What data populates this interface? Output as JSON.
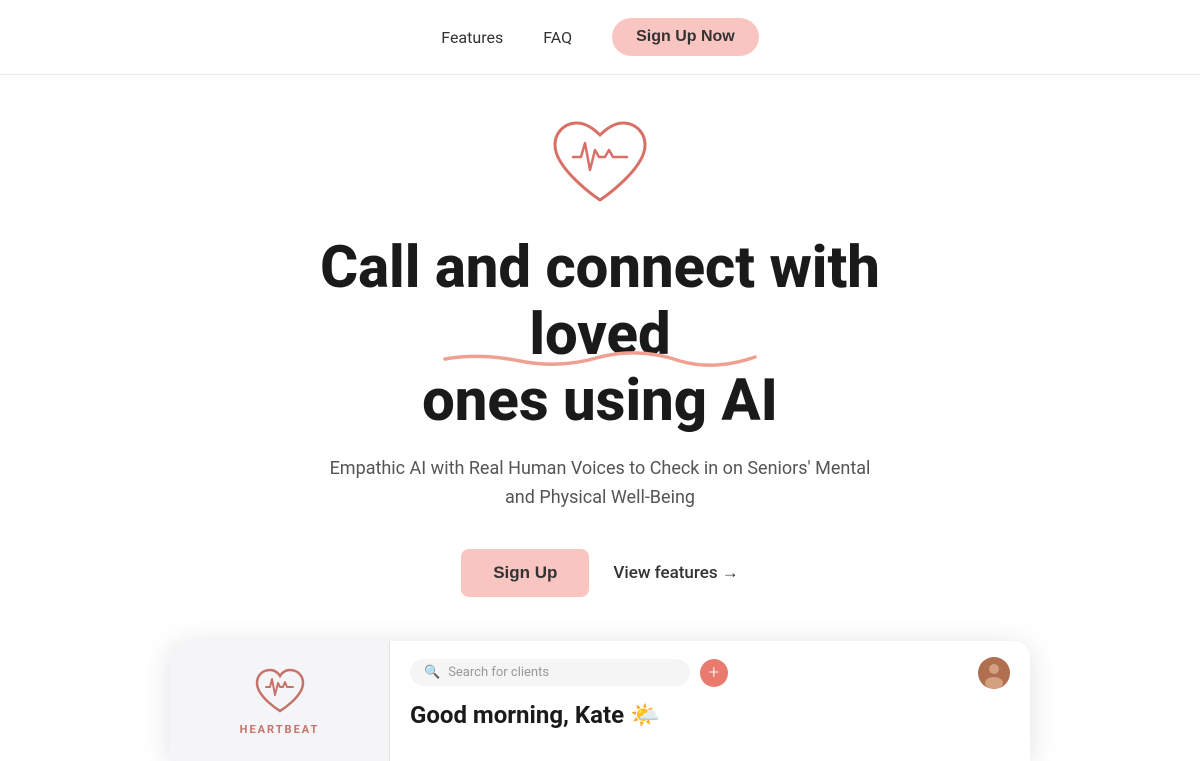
{
  "nav": {
    "features_label": "Features",
    "faq_label": "FAQ",
    "signup_now_label": "Sign Up Now"
  },
  "hero": {
    "title_line1": "Call and connect with loved",
    "title_line2": "ones using AI",
    "subtitle": "Empathic AI with Real Human Voices to Check in on Seniors' Mental and Physical Well-Being",
    "signup_label": "Sign Up",
    "view_features_label": "View features →"
  },
  "app_preview": {
    "search_placeholder": "Search for clients",
    "greeting": "Good morning, Kate 🌤️",
    "brand_name": "HEARTBEAT",
    "add_icon": "+"
  },
  "colors": {
    "accent": "#f9c5c0",
    "brand_red": "#c4746a",
    "button_red": "#e87a6e"
  }
}
